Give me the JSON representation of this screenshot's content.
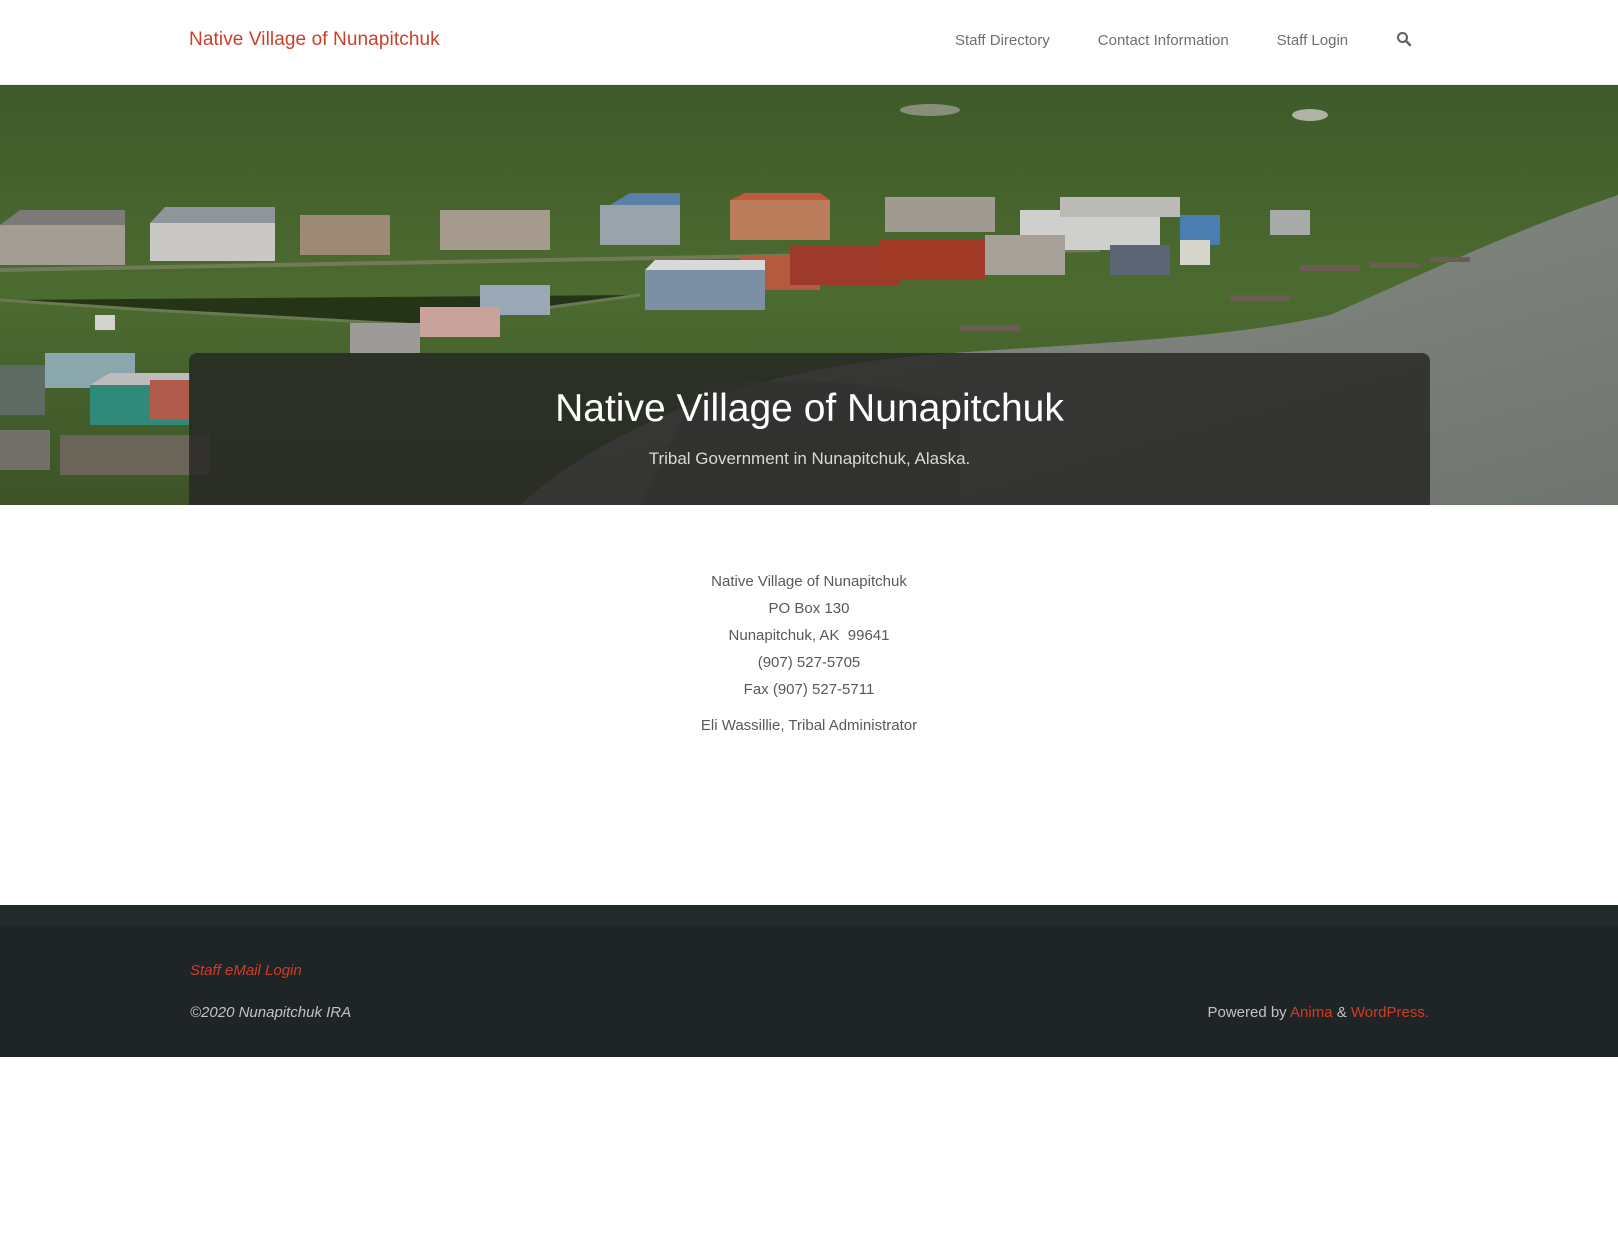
{
  "header": {
    "site_title": "Native Village of Nunapitchuk",
    "nav": [
      {
        "label": "Staff Directory"
      },
      {
        "label": "Contact Information"
      },
      {
        "label": "Staff Login"
      }
    ],
    "search_icon": "search-icon"
  },
  "hero": {
    "title": "Native Village of Nunapitchuk",
    "subtitle": "Tribal Government in Nunapitchuk, Alaska."
  },
  "contact": {
    "org": "Native Village of Nunapitchuk",
    "po_box": "PO Box 130",
    "city": "Nunapitchuk, AK  99641",
    "phone": "(907) 527-5705",
    "fax": "Fax (907) 527-5711",
    "administrator": "Eli Wassillie, Tribal Administrator"
  },
  "footer": {
    "email_login": "Staff eMail Login",
    "copyright": "©2020 Nunapitchuk IRA",
    "powered_by": "Powered by",
    "anima": "Anima",
    "amp": "&",
    "wordpress": "WordPress."
  },
  "colors": {
    "accent": "#c9412c",
    "footer_bg": "#1f2427"
  }
}
